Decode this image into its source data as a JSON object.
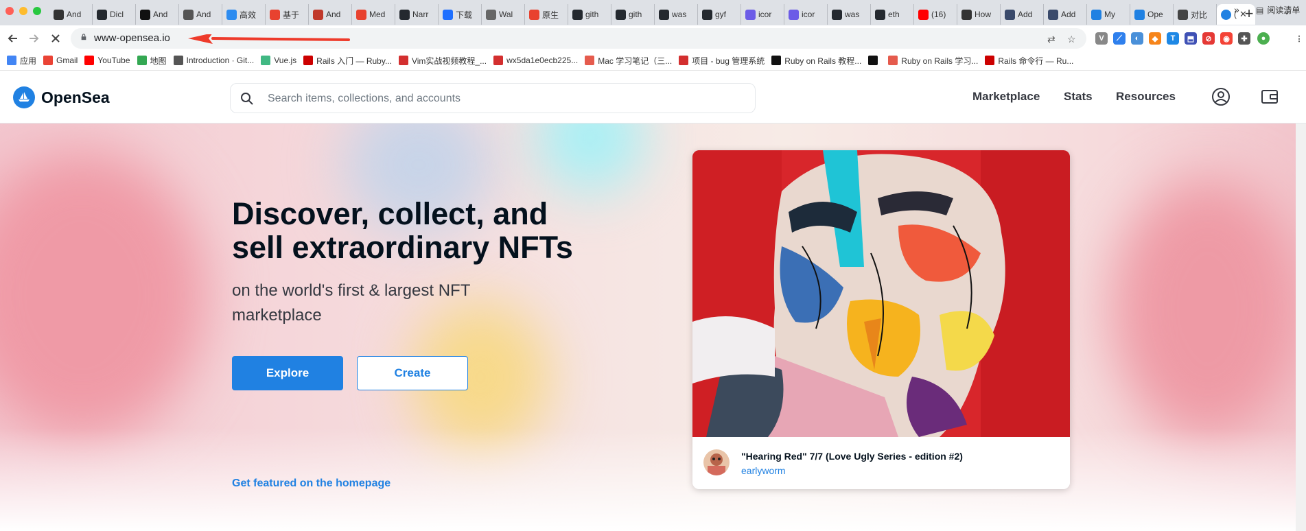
{
  "browser": {
    "tabs": [
      {
        "label": "And",
        "color": "#333"
      },
      {
        "label": "Dicl",
        "color": "#24292f"
      },
      {
        "label": "And",
        "color": "#111"
      },
      {
        "label": "And",
        "color": "#555"
      },
      {
        "label": "高效",
        "color": "#2d8cf0"
      },
      {
        "label": "基于",
        "color": "#e8422f"
      },
      {
        "label": "And",
        "color": "#c0392b"
      },
      {
        "label": "Med",
        "color": "#e8422f"
      },
      {
        "label": "Narr",
        "color": "#24292f"
      },
      {
        "label": "下载",
        "color": "#1e6fff"
      },
      {
        "label": "Wal",
        "color": "#666"
      },
      {
        "label": "原生",
        "color": "#e8422f"
      },
      {
        "label": "gith",
        "color": "#24292f"
      },
      {
        "label": "gith",
        "color": "#24292f"
      },
      {
        "label": "was",
        "color": "#24292f"
      },
      {
        "label": "gyf",
        "color": "#24292f"
      },
      {
        "label": "icor",
        "color": "#6c5ce7"
      },
      {
        "label": "icor",
        "color": "#6c5ce7"
      },
      {
        "label": "was",
        "color": "#24292f"
      },
      {
        "label": "eth",
        "color": "#24292f"
      },
      {
        "label": "(16)",
        "color": "#ff0000"
      },
      {
        "label": "How",
        "color": "#333"
      },
      {
        "label": "Add",
        "color": "#3a4a6b"
      },
      {
        "label": "Add",
        "color": "#3a4a6b"
      },
      {
        "label": "My",
        "color": "#2081e2"
      },
      {
        "label": "Ope",
        "color": "#2081e2"
      },
      {
        "label": "对比",
        "color": "#444"
      }
    ],
    "active_tab": {
      "label": "(",
      "color": "#2081e2"
    },
    "close_glyph": "✕",
    "new_tab_glyph": "+",
    "url": "www-opensea.io",
    "bookmarks": [
      {
        "label": "应用",
        "color": "#4285f4"
      },
      {
        "label": "Gmail",
        "color": "#ea4335"
      },
      {
        "label": "YouTube",
        "color": "#ff0000"
      },
      {
        "label": "地图",
        "color": "#34a853"
      },
      {
        "label": "Introduction · Git...",
        "color": "#555"
      },
      {
        "label": "Vue.js",
        "color": "#41b883"
      },
      {
        "label": "Rails 入门 — Ruby...",
        "color": "#cc0000"
      },
      {
        "label": "Vim实战视频教程_...",
        "color": "#d32f2f"
      },
      {
        "label": "wx5da1e0ecb225...",
        "color": "#d32f2f"
      },
      {
        "label": "Mac 学习笔记（三...",
        "color": "#e55b4d"
      },
      {
        "label": "项目 - bug 管理系统",
        "color": "#d32f2f"
      },
      {
        "label": "Ruby on Rails 教程...",
        "color": "#111"
      },
      {
        "label": "",
        "color": "#111"
      },
      {
        "label": "Ruby on Rails 学习...",
        "color": "#e55b4d"
      },
      {
        "label": "Rails 命令行 — Ru...",
        "color": "#cc0000"
      }
    ],
    "bookmarks_more": "»",
    "reading_list": "阅读清单"
  },
  "header": {
    "logo_text": "OpenSea",
    "search_placeholder": "Search items, collections, and accounts",
    "nav": [
      "Marketplace",
      "Stats",
      "Resources"
    ]
  },
  "hero": {
    "headline": "Discover, collect, and sell extraordinary NFTs",
    "subline": "on the world's first & largest NFT marketplace",
    "explore_label": "Explore",
    "create_label": "Create",
    "featured_link": "Get featured on the homepage"
  },
  "card": {
    "title": "\"Hearing Red\" 7/7 (Love Ugly Series - edition #2)",
    "author": "earlyworm"
  }
}
